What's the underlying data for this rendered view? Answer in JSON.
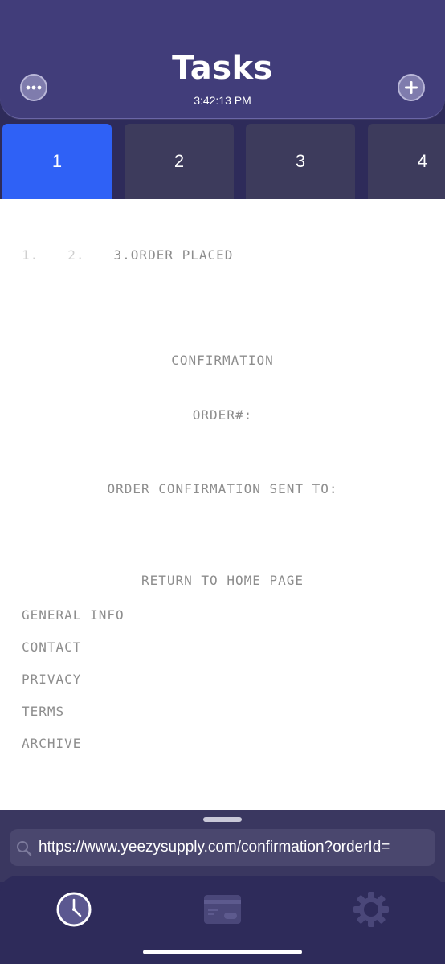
{
  "header": {
    "title": "Tasks",
    "time": "3:42:13 PM"
  },
  "tabs": [
    "1",
    "2",
    "3",
    "4"
  ],
  "page": {
    "steps": [
      "1.",
      "2.",
      "3.ORDER PLACED"
    ],
    "confirmation": "CONFIRMATION",
    "order_number_label": "ORDER#:",
    "sent_to_label": "ORDER CONFIRMATION SENT TO:",
    "return_home": "RETURN TO HOME PAGE",
    "footer_links": [
      "GENERAL INFO",
      "CONTACT",
      "PRIVACY",
      "TERMS",
      "ARCHIVE"
    ]
  },
  "url_bar": {
    "value": "https://www.yeezysupply.com/confirmation?orderId="
  },
  "tabbar": {
    "items": [
      "clock-icon",
      "card-icon",
      "gear-icon"
    ]
  },
  "colors": {
    "header": "#413d7a",
    "background": "#2e2b5a",
    "active_tab": "#2f61f6",
    "tab": "#3d3b5c"
  }
}
